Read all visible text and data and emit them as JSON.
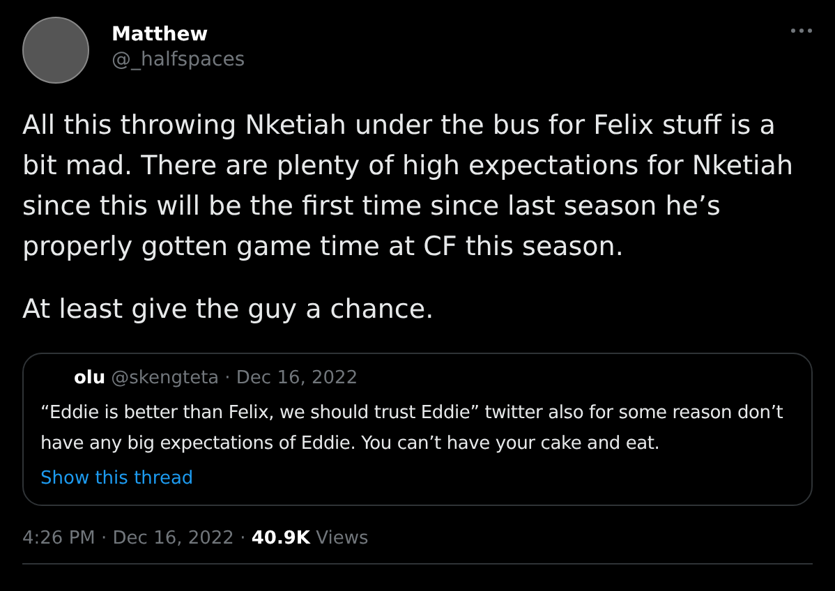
{
  "author": {
    "name": "Matthew",
    "handle": "@_halfspaces"
  },
  "body": [
    "All this throwing Nketiah under the bus for Felix stuff is a bit mad. There are plenty of high expectations for Nketiah since this will be the first time since last season he’s properly gotten game time at CF this season.",
    "At least give the guy a chance."
  ],
  "quote": {
    "name": "olu",
    "handle": "@skengteta",
    "date": "· Dec 16, 2022",
    "text": "“Eddie is better than Felix, we should trust Eddie” twitter also for some reason don’t have any big expectations of Eddie. You can’t have your cake and eat.",
    "link": "Show this thread"
  },
  "meta": "4:26 PM · Dec 16, 2022 · **40.9K** Views"
}
